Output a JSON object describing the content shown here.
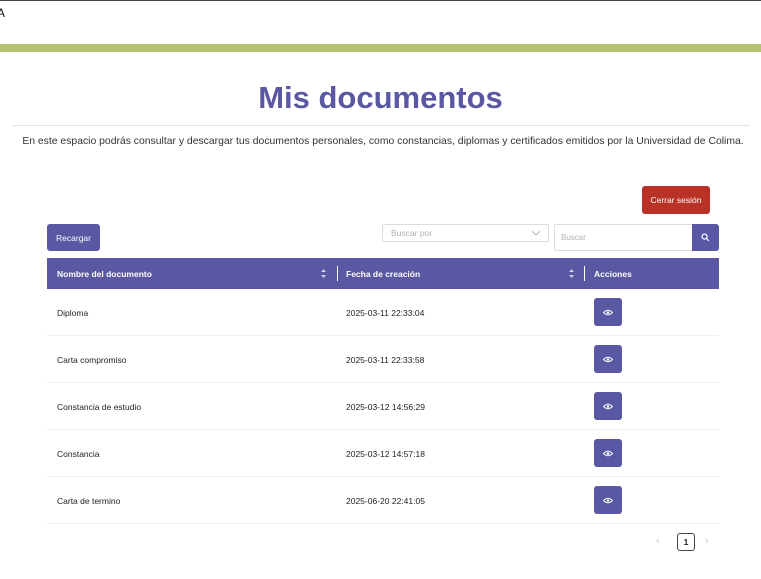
{
  "header": {
    "corner_glyph": "A",
    "title": "Mis documentos",
    "intro": "En este espacio podrás consultar y descargar tus documentos personales, como constancias, diplomas y certificados emitidos por la Universidad de Colima."
  },
  "toolbar": {
    "logout_label": "Cerrar sesión",
    "reload_label": "Recargar",
    "filter_placeholder": "Buscar por",
    "search_placeholder": "Buscar",
    "search_value": ""
  },
  "table": {
    "columns": [
      "Nombre del documento",
      "Fecha de creación",
      "Acciones"
    ],
    "rows": [
      {
        "name": "Diploma",
        "created": "2025-03-11 22:33:04"
      },
      {
        "name": "Carta compromiso",
        "created": "2025-03-11 22:33:58"
      },
      {
        "name": "Constancia de estudio",
        "created": "2025-03-12 14:56:29"
      },
      {
        "name": "Constancia",
        "created": "2025-03-12 14:57:18"
      },
      {
        "name": "Carta de termino",
        "created": "2025-06-20 22:41:05"
      }
    ],
    "row_action_icon": "eye-icon"
  },
  "pagination": {
    "prev": "‹",
    "current_page": "1",
    "next": "›"
  },
  "colors": {
    "primary": "#5a57a3",
    "danger": "#b83225",
    "band": "#b5c36e"
  }
}
